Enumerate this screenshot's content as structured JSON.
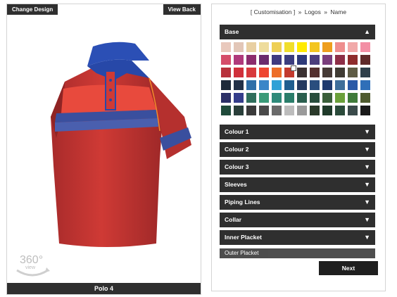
{
  "preview": {
    "change_design_label": "Change Design",
    "view_back_label": "View Back",
    "design_name": "Polo 4",
    "view360_label": "360°",
    "view360_sub": "view"
  },
  "breadcrumb": {
    "items": [
      "[ Customisation ]",
      "»",
      "Logos",
      "»",
      "Name"
    ]
  },
  "base_section": {
    "label": "Base",
    "selected_color": "#c33a2e",
    "palette": [
      "#e9c9bd",
      "#e2c6b7",
      "#e8cfa2",
      "#eedc9c",
      "#eecf54",
      "#f0de2c",
      "#ffea00",
      "#f3c51f",
      "#ee9e1e",
      "#ee8e8e",
      "#f1a9a9",
      "#f38fa5",
      "#d54d6a",
      "#b0397b",
      "#8c2c6d",
      "#6b2b6d",
      "#3f3a7f",
      "#3b3d7e",
      "#2e3a79",
      "#4b3e7c",
      "#7a3e7c",
      "#8d2f47",
      "#8e2c2c",
      "#5f2a2a",
      "#b8323c",
      "#d0303b",
      "#d8393c",
      "#ee4631",
      "#ed6d28",
      "#c33a2e",
      "#3b3132",
      "#54302f",
      "#463a36",
      "#3f3b33",
      "#5f5c45",
      "#2f3f4a",
      "#1e2a3a",
      "#223047",
      "#2f6fa8",
      "#3a86c8",
      "#2fa1d6",
      "#1f5e8f",
      "#253b61",
      "#2a4e7e",
      "#1f3a6e",
      "#3e6e9a",
      "#2a5aa7",
      "#2f6fb8",
      "#2b2f66",
      "#343d8b",
      "#2f6e5c",
      "#3a9a78",
      "#2e8a7a",
      "#2a7d6a",
      "#2a5e4e",
      "#284d3c",
      "#3a5f3a",
      "#6aa03a",
      "#3f7a3a",
      "#4e5a2e",
      "#1f4a3a",
      "#2a3f3a",
      "#3a3a3a",
      "#4a4a4a",
      "#6a6a6a",
      "#bcbcbc",
      "#9a9a9a",
      "#2a3a2a",
      "#1f3a2a",
      "#2a4a3a",
      "#3a4a4a",
      "#1a1a1a"
    ]
  },
  "sections": [
    {
      "label": "Colour 1"
    },
    {
      "label": "Colour 2"
    },
    {
      "label": "Colour 3"
    },
    {
      "label": "Sleeves"
    },
    {
      "label": "Piping Lines"
    },
    {
      "label": "Collar"
    },
    {
      "label": "Inner Placket"
    }
  ],
  "partial_section": {
    "label": "Outer Placket"
  },
  "next_label": "Next"
}
